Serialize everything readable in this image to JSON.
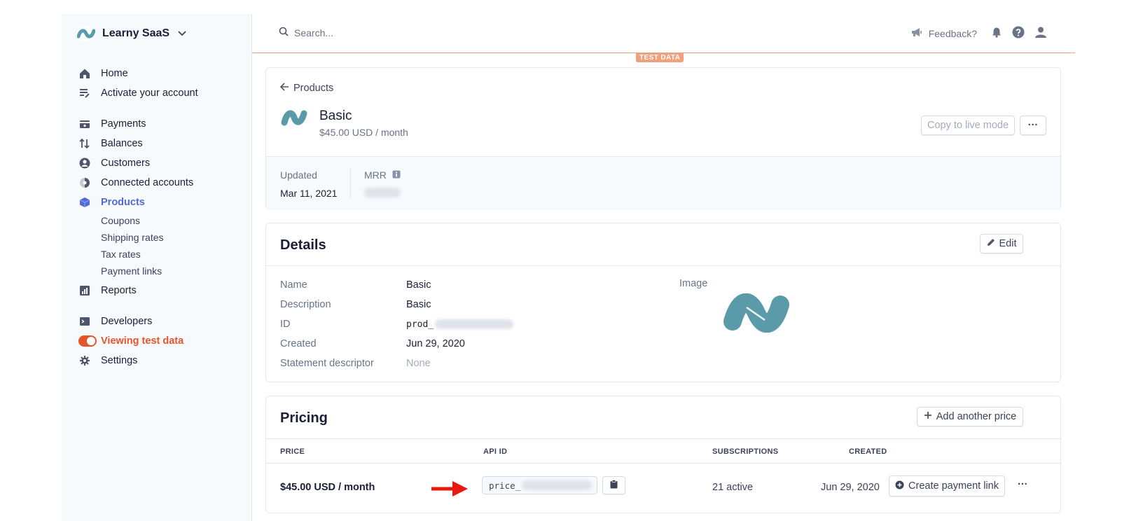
{
  "sidebar": {
    "account_name": "Learny SaaS",
    "nav_primary": [
      {
        "label": "Home",
        "icon": "home-icon"
      },
      {
        "label": "Activate your account",
        "icon": "checklist-icon"
      }
    ],
    "nav_main": [
      {
        "label": "Payments",
        "icon": "payments-icon"
      },
      {
        "label": "Balances",
        "icon": "balances-icon"
      },
      {
        "label": "Customers",
        "icon": "customers-icon"
      },
      {
        "label": "Connected accounts",
        "icon": "connected-accounts-icon"
      },
      {
        "label": "Products",
        "icon": "products-icon",
        "active": true
      }
    ],
    "products_sub": [
      "Coupons",
      "Shipping rates",
      "Tax rates",
      "Payment links"
    ],
    "reports": {
      "label": "Reports",
      "icon": "reports-icon"
    },
    "developers": {
      "label": "Developers",
      "icon": "terminal-icon"
    },
    "test_toggle": {
      "label": "Viewing test data",
      "on": true
    },
    "settings": {
      "label": "Settings",
      "icon": "gear-icon"
    }
  },
  "topbar": {
    "search_placeholder": "Search...",
    "feedback_label": "Feedback?",
    "test_data_badge": "TEST DATA"
  },
  "product": {
    "back_label": "Products",
    "name": "Basic",
    "price_summary": "$45.00 USD / month",
    "copy_live_label": "Copy to live mode",
    "more_label": "···",
    "updated_label": "Updated",
    "updated_value": "Mar 11, 2021",
    "mrr_label": "MRR"
  },
  "details": {
    "title": "Details",
    "edit_label": "Edit",
    "rows": [
      {
        "key": "Name",
        "value": "Basic"
      },
      {
        "key": "Description",
        "value": "Basic"
      },
      {
        "key": "ID",
        "value": "prod_"
      },
      {
        "key": "Created",
        "value": "Jun 29, 2020"
      },
      {
        "key": "Statement descriptor",
        "value": "None"
      }
    ],
    "image_label": "Image"
  },
  "pricing": {
    "title": "Pricing",
    "add_price_label": "Add another price",
    "columns": [
      "PRICE",
      "API ID",
      "SUBSCRIPTIONS",
      "CREATED"
    ],
    "row": {
      "price": "$45.00 USD / month",
      "api_id_prefix": "price_",
      "subscriptions": "21 active",
      "created": "Jun 29, 2020",
      "create_link_label": "Create payment link",
      "more_label": "···"
    }
  },
  "colors": {
    "accent": "#5469d4",
    "test_orange": "#f0a07d",
    "danger_orange": "#e5542a",
    "logo_teal": "#5b9aa9",
    "arrow_red": "#e8190e"
  }
}
